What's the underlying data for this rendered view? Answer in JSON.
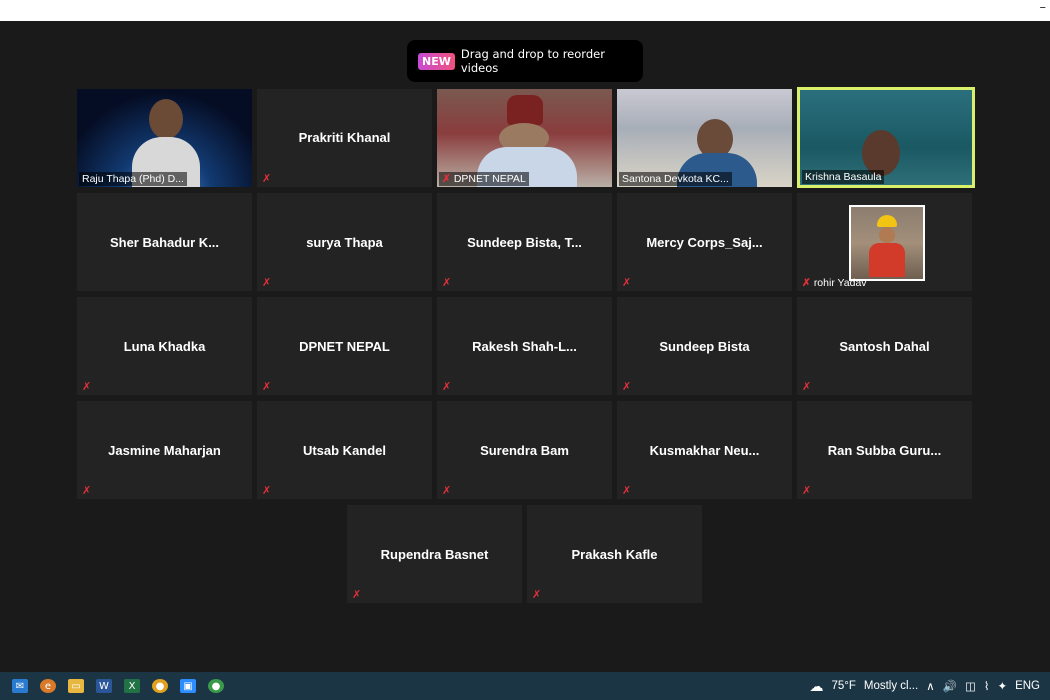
{
  "toast": {
    "badge": "NEW",
    "message": "Drag and drop to reorder videos"
  },
  "tiles": [
    {
      "name": "Raju Thapa (Phd) D...",
      "video": true,
      "muted": false
    },
    {
      "name": "Prakriti Khanal",
      "video": false,
      "muted": true
    },
    {
      "name": "DPNET NEPAL",
      "video": true,
      "muted": true
    },
    {
      "name": "Santona Devkota KC...",
      "video": true,
      "muted": false
    },
    {
      "name": "Krishna Basaula",
      "video": true,
      "muted": false,
      "active": true
    },
    {
      "name": "Sher  Bahadur  K...",
      "video": false,
      "muted": false
    },
    {
      "name": "surya Thapa",
      "video": false,
      "muted": true
    },
    {
      "name": "Sundeep  Bista,  T...",
      "video": false,
      "muted": true
    },
    {
      "name": "Mercy  Corps_Saj...",
      "video": false,
      "muted": true
    },
    {
      "name": "rohir Yadav",
      "video": false,
      "muted": true,
      "avatar": true
    },
    {
      "name": "Luna Khadka",
      "video": false,
      "muted": true
    },
    {
      "name": "DPNET NEPAL",
      "video": false,
      "muted": true
    },
    {
      "name": "Rakesh  Shah-L...",
      "video": false,
      "muted": true
    },
    {
      "name": "Sundeep Bista",
      "video": false,
      "muted": true
    },
    {
      "name": "Santosh Dahal",
      "video": false,
      "muted": true
    },
    {
      "name": "Jasmine Maharjan",
      "video": false,
      "muted": true
    },
    {
      "name": "Utsab Kandel",
      "video": false,
      "muted": true
    },
    {
      "name": "Surendra Bam",
      "video": false,
      "muted": true
    },
    {
      "name": "Kusmakhar  Neu...",
      "video": false,
      "muted": true
    },
    {
      "name": "Ran  Subba  Guru...",
      "video": false,
      "muted": true
    },
    {
      "name": "Rupendra Basnet",
      "video": false,
      "muted": true
    },
    {
      "name": "Prakash Kafle",
      "video": false,
      "muted": true
    }
  ],
  "taskbar": {
    "weather": "75°F",
    "weather_text": "Mostly cl...",
    "language": "ENG"
  },
  "colors": {
    "active_border": "#d9f06a",
    "muted_red": "#e0303a",
    "tile_bg": "#232323"
  }
}
